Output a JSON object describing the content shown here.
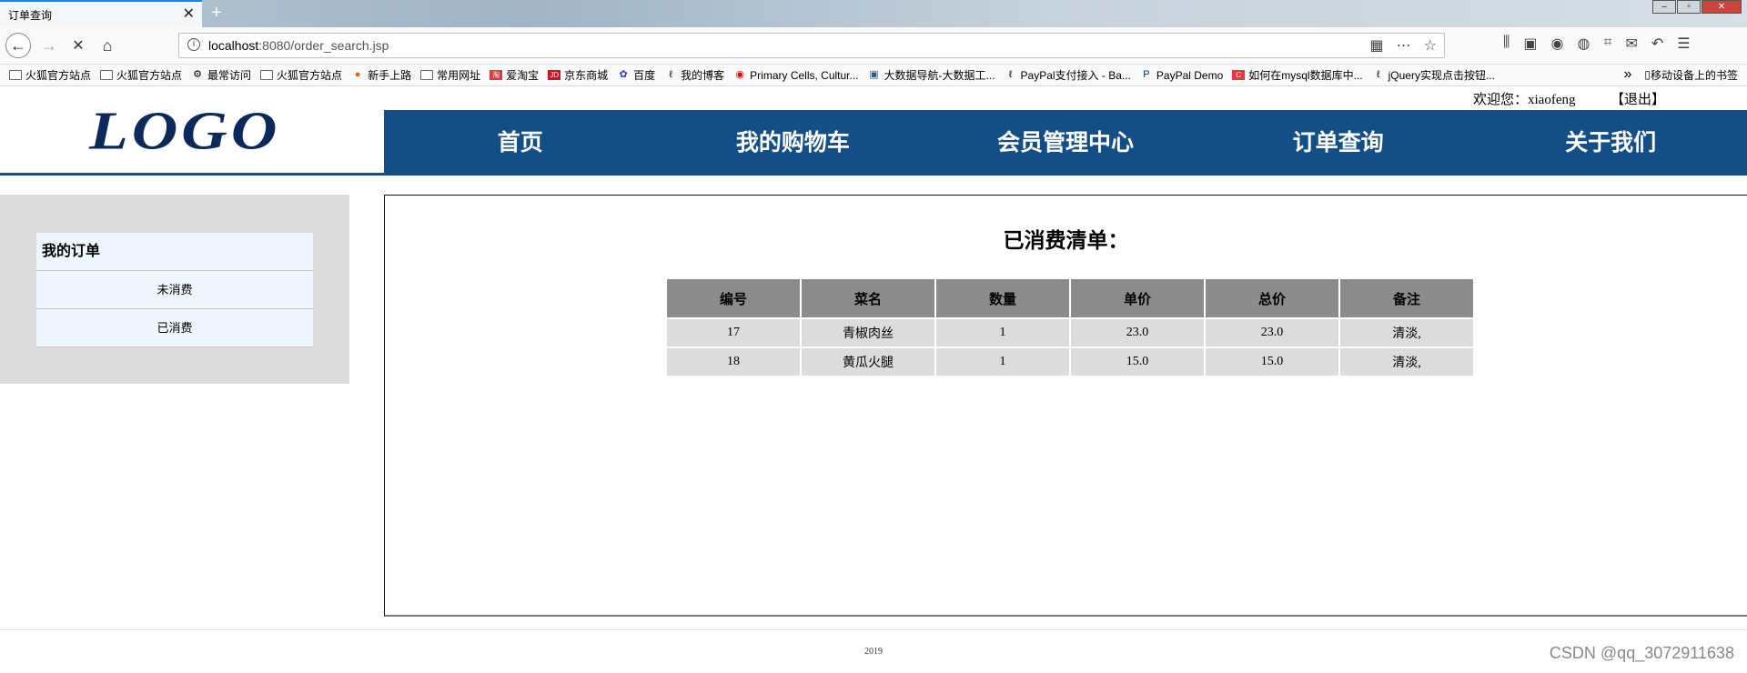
{
  "browser": {
    "tab_title": "订单查询",
    "tab_close": "✕",
    "new_tab": "+",
    "url_host": "localhost",
    "url_rest": ":8080/order_search.jsp",
    "bookmarks": [
      {
        "label": "火狐官方站点",
        "icon": "folder"
      },
      {
        "label": "火狐官方站点",
        "icon": "folder"
      },
      {
        "label": "最常访问",
        "icon": "gear"
      },
      {
        "label": "火狐官方站点",
        "icon": "folder"
      },
      {
        "label": "新手上路",
        "icon": "firefox"
      },
      {
        "label": "常用网址",
        "icon": "folder"
      },
      {
        "label": "爱淘宝",
        "icon": "taobao"
      },
      {
        "label": "京东商城",
        "icon": "jd"
      },
      {
        "label": "百度",
        "icon": "baidu"
      },
      {
        "label": "我的博客",
        "icon": "blog"
      },
      {
        "label": "Primary Cells, Cultur...",
        "icon": "red-dot"
      },
      {
        "label": "大数据导航-大数据工...",
        "icon": "image"
      },
      {
        "label": "PayPal支付接入 - Ba...",
        "icon": "blog"
      },
      {
        "label": "PayPal Demo",
        "icon": "paypal"
      },
      {
        "label": "如何在mysql数据库中...",
        "icon": "csdn"
      },
      {
        "label": "jQuery实现点击按钮...",
        "icon": "blog"
      }
    ],
    "mobile_bookmarks": "移动设备上的书签",
    "more_chevron": "»"
  },
  "header": {
    "welcome": "欢迎您：xiaofeng",
    "logout": "【退出】",
    "logo": "LOGO",
    "nav": [
      "首页",
      "我的购物车",
      "会员管理中心",
      "订单查询",
      "关于我们"
    ]
  },
  "sidebar": {
    "title": "我的订单",
    "items": [
      "未消费",
      "已消费"
    ]
  },
  "content": {
    "title": "已消费清单：",
    "table": {
      "headers": [
        "编号",
        "菜名",
        "数量",
        "单价",
        "总价",
        "备注"
      ],
      "rows": [
        [
          "17",
          "青椒肉丝",
          "1",
          "23.0",
          "23.0",
          "清淡,"
        ],
        [
          "18",
          "黄瓜火腿",
          "1",
          "15.0",
          "15.0",
          "清淡,"
        ]
      ]
    }
  },
  "footer": {
    "year": "2019",
    "watermark": "CSDN @qq_3072911638"
  }
}
